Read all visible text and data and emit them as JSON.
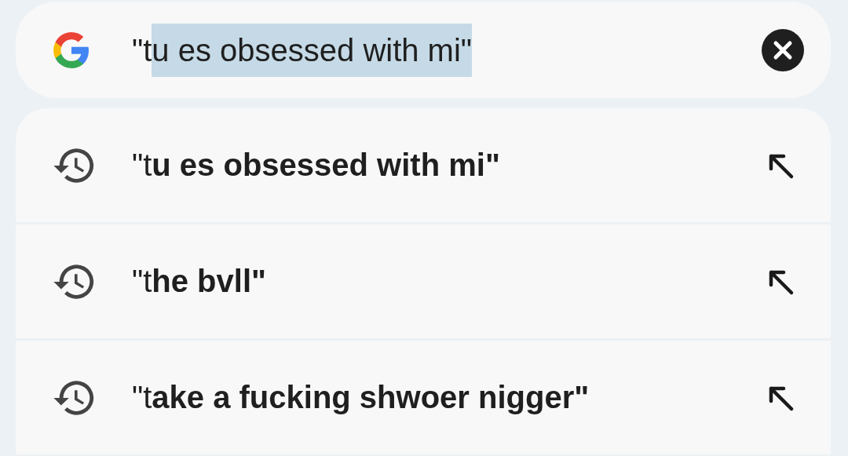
{
  "search": {
    "value_parts": [
      {
        "text": "\"t",
        "selected": false
      },
      {
        "text": "u es obsessed with mi\"",
        "selected": true
      }
    ]
  },
  "suggestions": [
    {
      "text": "\"t**u es obsessed with mi\"**"
    },
    {
      "text": "\"t**he bvll\"**"
    },
    {
      "text": "\"t**ake a fucking shwoer nigger\"**"
    }
  ]
}
